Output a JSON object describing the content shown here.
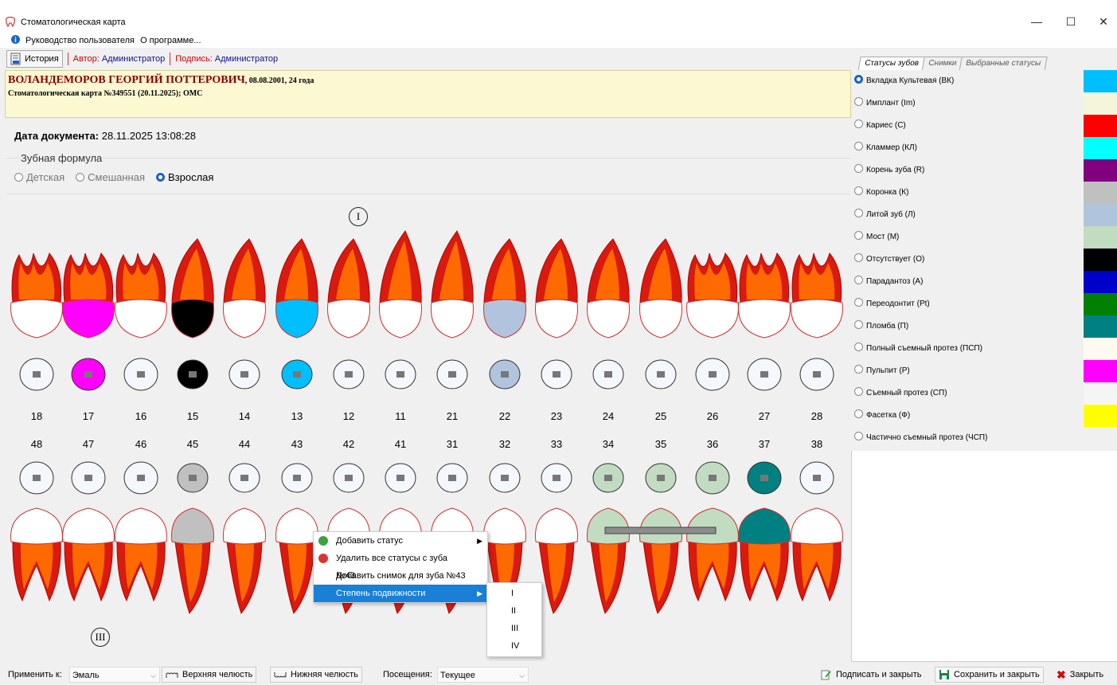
{
  "window": {
    "title": "Стоматологическая карта",
    "minimize": "—",
    "maximize": "☐",
    "close": "✕"
  },
  "menu": {
    "guide": "Руководство пользователя",
    "about": "О программе..."
  },
  "toolbar": {
    "history": "История",
    "author_label": "Автор:",
    "author": "Администратор",
    "sign_label": "Подпись:",
    "signer": "Администратор"
  },
  "patient": {
    "name": "ВОЛАНДЕМОРОВ ГЕОРГИЙ ПОТТЕРОВИЧ",
    "dob": ", 08.08.2001, 24 года",
    "card": "Стоматологическая карта №349551 (20.11.2025); ОМС"
  },
  "document": {
    "date_label": "Дата документа:",
    "date_value": "28.11.2025 13:08:28"
  },
  "formula": {
    "legend": "Зубная формула",
    "options": [
      "Детская",
      "Смешанная",
      "Взрослая"
    ],
    "selected": "Взрослая"
  },
  "jaw_labels": {
    "upper": "I",
    "lower": "III"
  },
  "upper_numbers": [
    "18",
    "17",
    "16",
    "15",
    "14",
    "13",
    "12",
    "11",
    "21",
    "22",
    "23",
    "24",
    "25",
    "26",
    "27",
    "28"
  ],
  "lower_numbers": [
    "48",
    "47",
    "46",
    "45",
    "44",
    "43",
    "42",
    "41",
    "31",
    "32",
    "33",
    "34",
    "35",
    "36",
    "37",
    "38"
  ],
  "context_menu": {
    "items": [
      "Добавить статус",
      "Удалить все статусы с зуба №43",
      "Добавить снимок для зуба №43",
      "Степень подвижности"
    ],
    "submenu": [
      "I",
      "II",
      "III",
      "IV"
    ]
  },
  "tabs": [
    "Статусы зубов",
    "Снимки",
    "Выбранные статусы"
  ],
  "statuses": [
    {
      "label": "Вкладка Культевая (ВК)",
      "color": "#00bfff"
    },
    {
      "label": "Имплант (Im)",
      "color": "#f5f5dc"
    },
    {
      "label": "Кариес (C)",
      "color": "#ff0000"
    },
    {
      "label": "Кламмер (КЛ)",
      "color": "#00ffff"
    },
    {
      "label": "Корень зуба (R)",
      "color": "#800080"
    },
    {
      "label": "Коронка (К)",
      "color": "#c0c0c0"
    },
    {
      "label": "Литой зуб (Л)",
      "color": "#b0c4de"
    },
    {
      "label": "Мост (М)",
      "color": "#c1dcc1"
    },
    {
      "label": "Отсутствует (О)",
      "color": "#000000"
    },
    {
      "label": "Парадантоз (А)",
      "color": "#0000cd"
    },
    {
      "label": "Переодонтит (Pt)",
      "color": "#008000"
    },
    {
      "label": "Пломба (П)",
      "color": "#008080"
    },
    {
      "label": "Полный съемный протез (ПСП)",
      "color": "#fffaf0"
    },
    {
      "label": "Пульпит (Р)",
      "color": "#ff00ff"
    },
    {
      "label": "Съемный протез (СП)",
      "color": "#f5f5f5"
    },
    {
      "label": "Фасетка (Ф)",
      "color": "#ffff00"
    },
    {
      "label": "Частично съемный протез (ЧСП)",
      "color": "#f0f0f0"
    }
  ],
  "selected_status": "Вкладка Культевая (ВК)",
  "bottom": {
    "apply_label": "Применить к:",
    "apply_value": "Эмаль",
    "upper_jaw": "Верхняя челюсть",
    "lower_jaw": "Нижняя челюсть",
    "visits_label": "Посещения:",
    "visits_value": "Текущее",
    "sign_close": "Подписать и закрыть",
    "save_close": "Сохранить и закрыть",
    "close": "Закрыть"
  },
  "upper_fill": [
    "#ffffff",
    "#ff00ff",
    "#ffffff",
    "#000000",
    "#ffffff",
    "#00bfff",
    "#ffffff",
    "#ffffff",
    "#ffffff",
    "#b0c4de",
    "#ffffff",
    "#ffffff",
    "#ffffff",
    "#ffffff",
    "#ffffff",
    "#ffffff"
  ],
  "lower_fill": [
    "#ffffff",
    "#ffffff",
    "#ffffff",
    "#c0c0c0",
    "#ffffff",
    "#ffffff",
    "#ffffff",
    "#ffffff",
    "#ffffff",
    "#ffffff",
    "#ffffff",
    "#c1dcc1",
    "#c1dcc1",
    "#c1dcc1",
    "#008080",
    "#ffffff"
  ]
}
